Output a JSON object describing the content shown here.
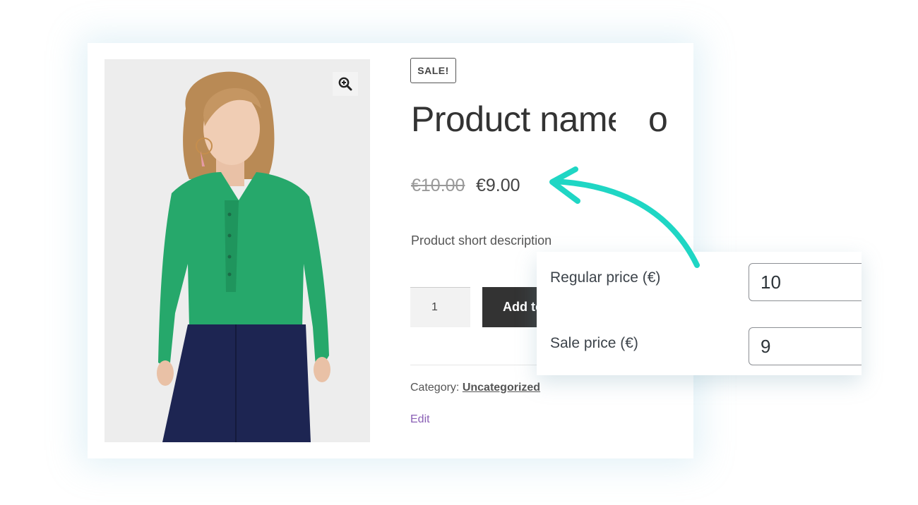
{
  "product": {
    "badge": "SALE!",
    "title": "Product name",
    "title_tail": "o",
    "price_old": "€10.00",
    "price_new": "€9.00",
    "short_description": "Product short description",
    "quantity": "1",
    "add_to_cart_label": "Add to cart",
    "category_label": "Category:",
    "category_value": "Uncategorized",
    "edit_label": "Edit"
  },
  "admin": {
    "regular_price_label": "Regular price (€)",
    "regular_price_value": "10",
    "sale_price_label": "Sale price (€)",
    "sale_price_value": "9"
  },
  "colors": {
    "accent_arrow": "#1fd6c4",
    "shirt": "#26a86b",
    "trousers": "#1d2552",
    "button": "#333333",
    "edit_link": "#8a60b5"
  },
  "icons": {
    "zoom": "zoom-in-icon",
    "arrow": "curved-arrow-icon"
  }
}
